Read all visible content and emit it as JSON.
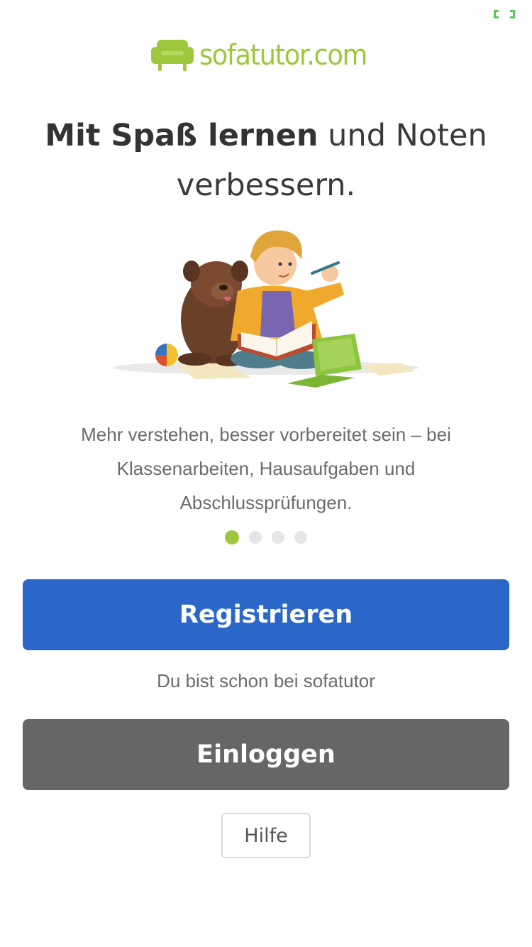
{
  "brand": {
    "name": "sofatutor.com",
    "color": "#9ec73c",
    "logo_icon": "sofa-icon"
  },
  "headline": {
    "bold": "Mit Spaß lernen",
    "regular": " und Noten verbessern."
  },
  "illustration": {
    "icon": "boy-with-dog-illustration"
  },
  "description": "Mehr verstehen, besser vorbereitet sein – bei Klassenarbeiten, Hausaufgaben und Abschlussprüfungen.",
  "pager": {
    "total": 4,
    "active_index": 0,
    "active_color": "#9ec73c",
    "inactive_color": "#e6e6e6"
  },
  "actions": {
    "register_label": "Registrieren",
    "register_color": "#2a67c9",
    "already_text": "Du bist schon bei sofatutor",
    "login_label": "Einloggen",
    "login_color": "#666666",
    "help_label": "Hilfe"
  },
  "status": {
    "icon": "expand-icon",
    "color": "#5cc85a"
  }
}
